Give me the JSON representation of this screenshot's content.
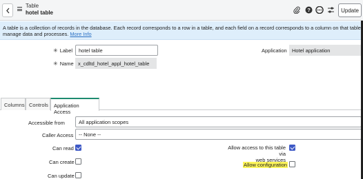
{
  "header": {
    "title_line1": "Table",
    "title_line2": "hotel table",
    "update_label": "Update"
  },
  "banner": {
    "text_line1": "A table is a collection of records in the database. Each record corresponds to a row in a table, and each field on a record corresponds to a column on that table. Applications use tables and records to",
    "text_line2": "manage data and processes.",
    "link_text": "More Info"
  },
  "form": {
    "label_field": {
      "label": "Label",
      "value": "hotel table"
    },
    "name_field": {
      "label": "Name",
      "value": "x_cdltd_hotel_appl_hotel_table"
    },
    "application_field": {
      "label": "Application",
      "value": "Hotel application"
    }
  },
  "tabs": [
    {
      "label": "Columns"
    },
    {
      "label": "Controls"
    },
    {
      "label": "Application Access"
    }
  ],
  "access": {
    "accessible_from": {
      "label": "Accessible from",
      "value": "All application scopes"
    },
    "caller_access": {
      "label": "Caller Access",
      "value": "-- None --"
    },
    "can_read": {
      "label": "Can read",
      "checked": true
    },
    "can_create": {
      "label": "Can create",
      "checked": false
    },
    "can_update": {
      "label": "Can update",
      "checked": false
    },
    "allow_web_services": {
      "label_line1": "Allow access to this table via",
      "label_line2": "web services",
      "checked": true
    },
    "allow_configuration": {
      "label": "Allow configuration",
      "checked": false
    }
  },
  "colors": {
    "accent_tab": "#1d8b6f",
    "checkbox_checked": "#3e59c6",
    "banner_bg": "#deeefb",
    "highlight": "#fdf55a"
  }
}
